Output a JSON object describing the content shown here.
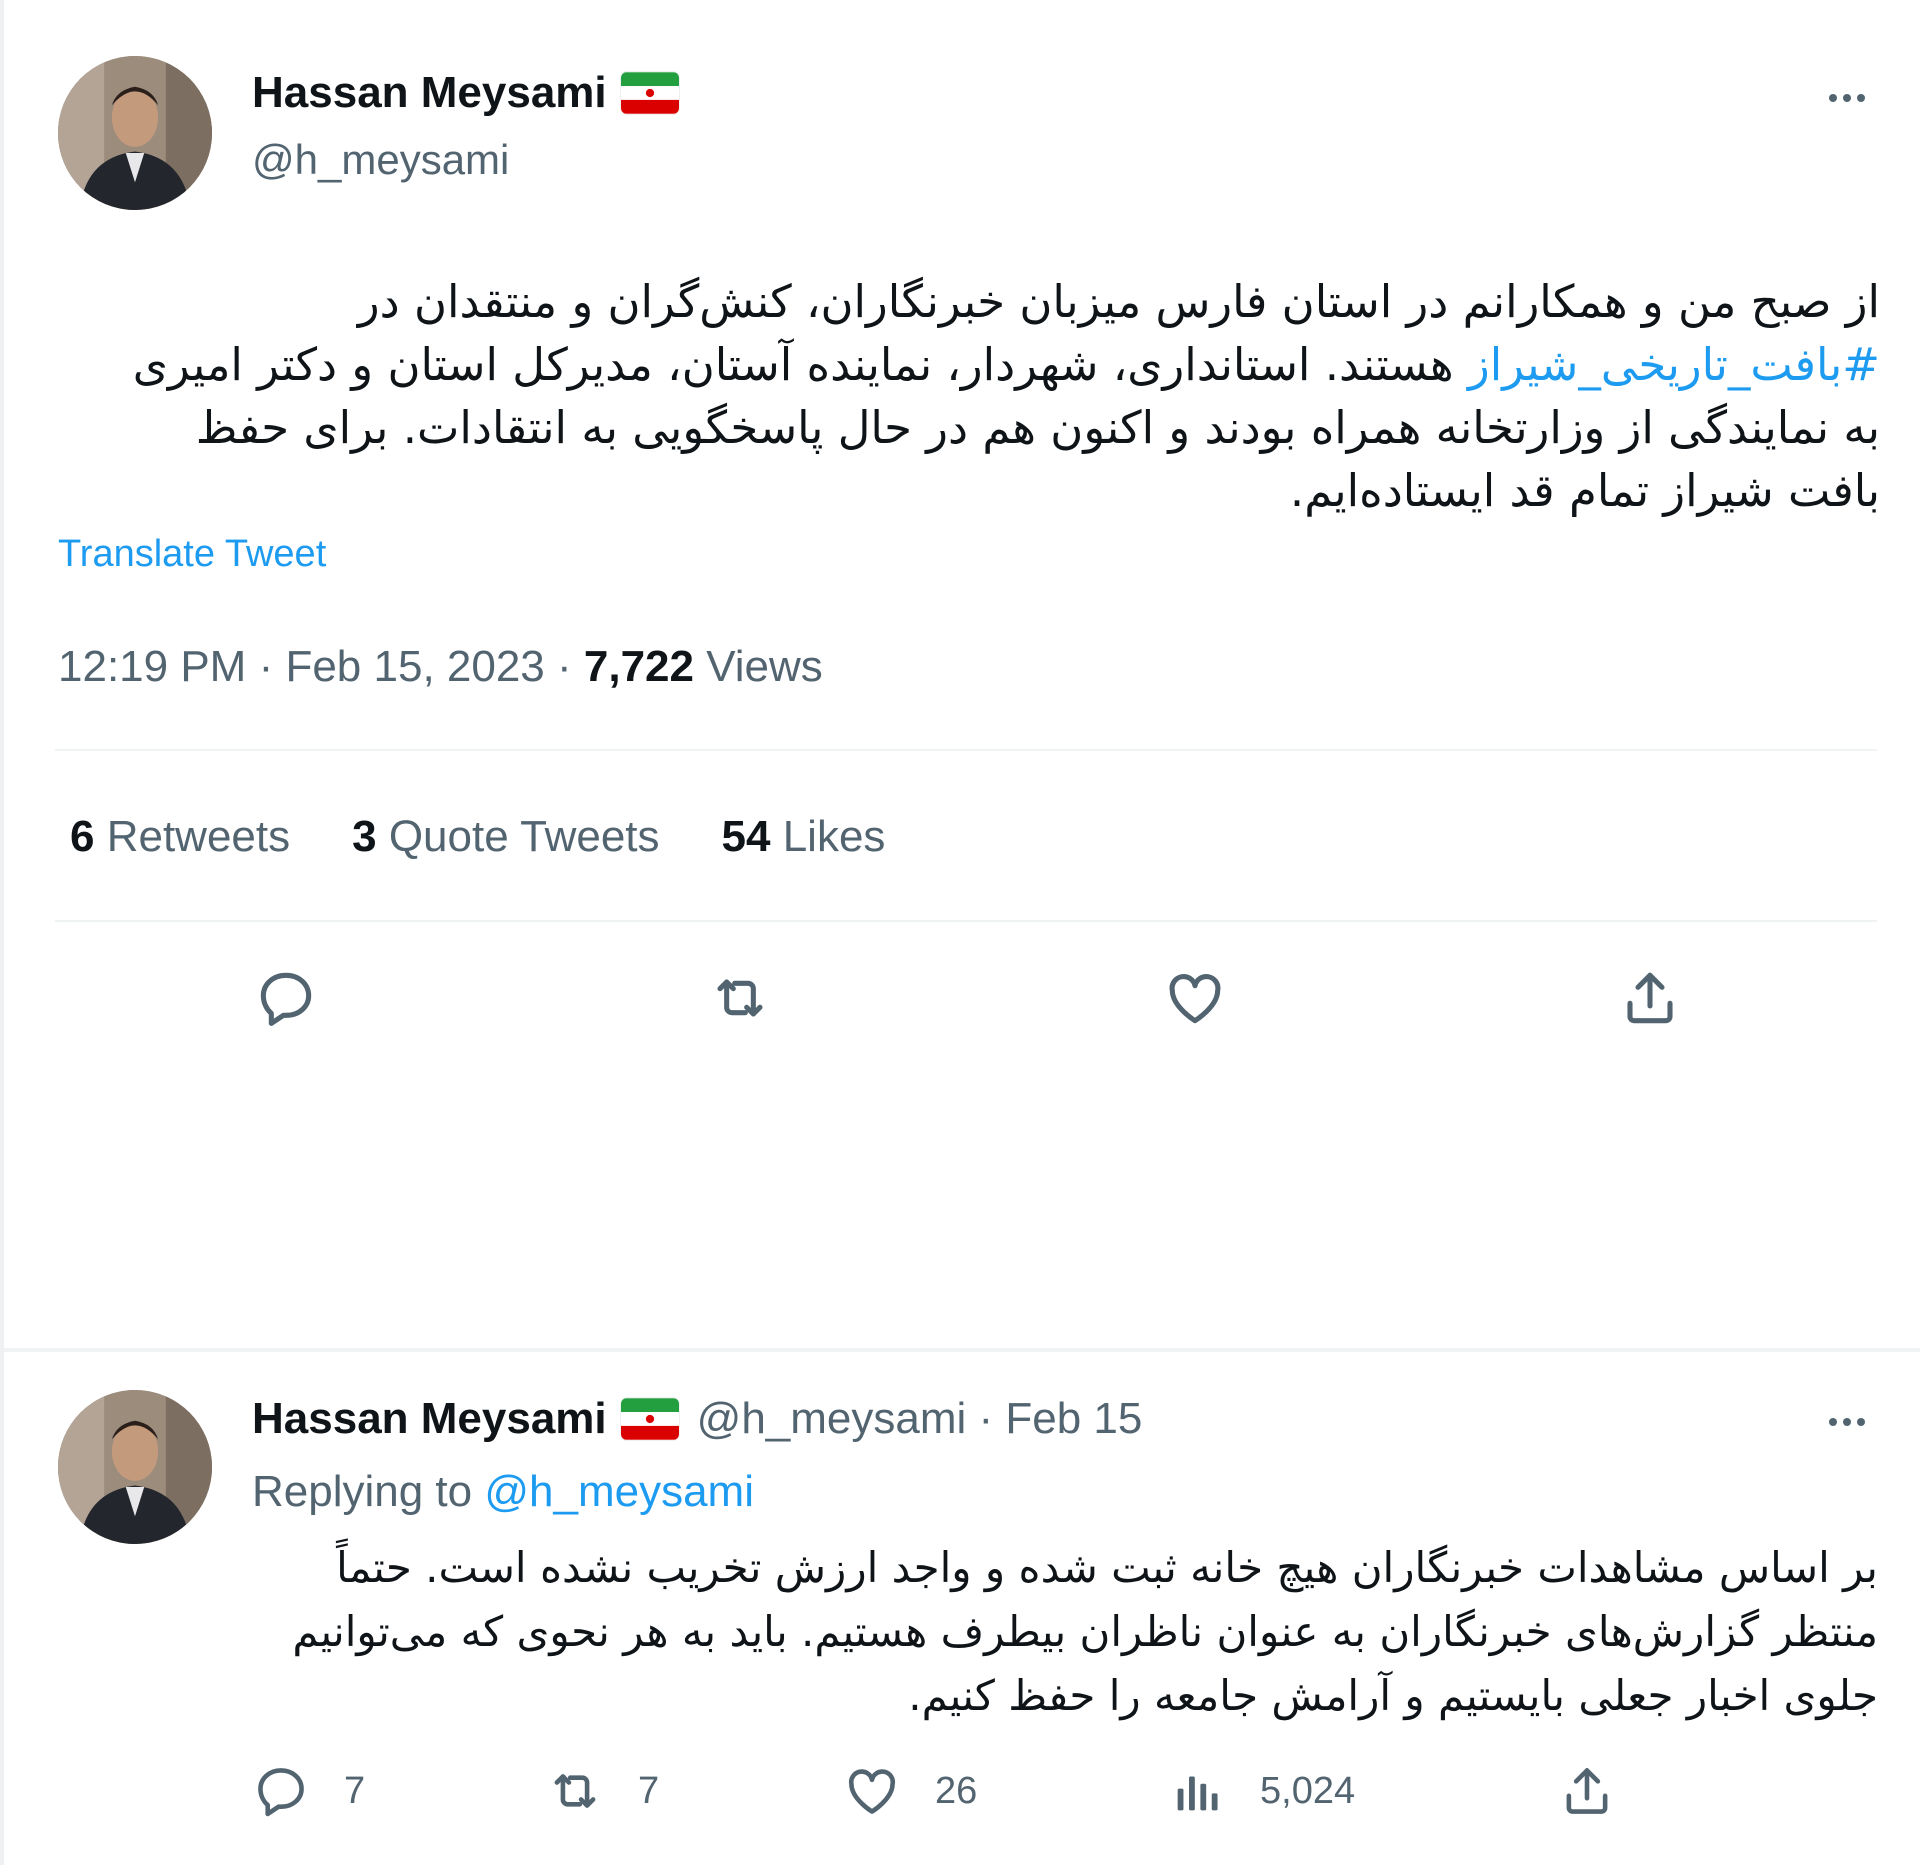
{
  "tweet": {
    "display_name": "Hassan Meysami",
    "handle": "@h_meysami",
    "text_part1": "از صبح من و همکارانم در استان فارس میزبان خبرنگاران، کنش‌گران و منتقدان در ",
    "hashtag": "#بافت_تاریخی_شیراز",
    "text_part2": " هستند. استانداری، شهردار، نماینده آستان، مدیرکل استان و دکتر امیری به نمایندگی از وزارتخانه همراه بودند و اکنون هم در حال پاسخگویی به انتقادات. برای حفظ بافت شیراز تمام قد ایستاده‌ایم.",
    "translate_label": "Translate Tweet",
    "time": "12:19 PM",
    "separator": " · ",
    "date": "Feb 15, 2023",
    "views_count": "7,722",
    "views_label": " Views",
    "stats": {
      "retweets_count": "6",
      "retweets_label": " Retweets",
      "quotes_count": "3",
      "quotes_label": " Quote Tweets",
      "likes_count": "54",
      "likes_label": " Likes"
    },
    "icons": {
      "reply": "reply-icon",
      "retweet": "retweet-icon",
      "like": "heart-icon",
      "share": "share-icon",
      "more": "more-icon"
    }
  },
  "reply": {
    "display_name": "Hassan Meysami",
    "handle_date": "@h_meysami · Feb 15",
    "replying_label": "Replying to ",
    "replying_to": "@h_meysami",
    "text": "بر اساس مشاهدات خبرنگاران هیچ خانه ثبت شده و واجد ارزش تخریب نشده است. حتماً منتظر گزارش‌های خبرنگاران به عنوان ناظران بیطرف هستیم. باید به هر نحوی که می‌توانیم جلوی اخبار جعلی بایستیم و آرامش جامعه را حفظ کنیم.",
    "counts": {
      "replies": "7",
      "retweets": "7",
      "likes": "26",
      "views": "5,024"
    }
  },
  "colors": {
    "accent": "#1d9bf0",
    "secondary_text": "#536471",
    "primary_text": "#0f1419",
    "divider": "#eff3f4"
  }
}
